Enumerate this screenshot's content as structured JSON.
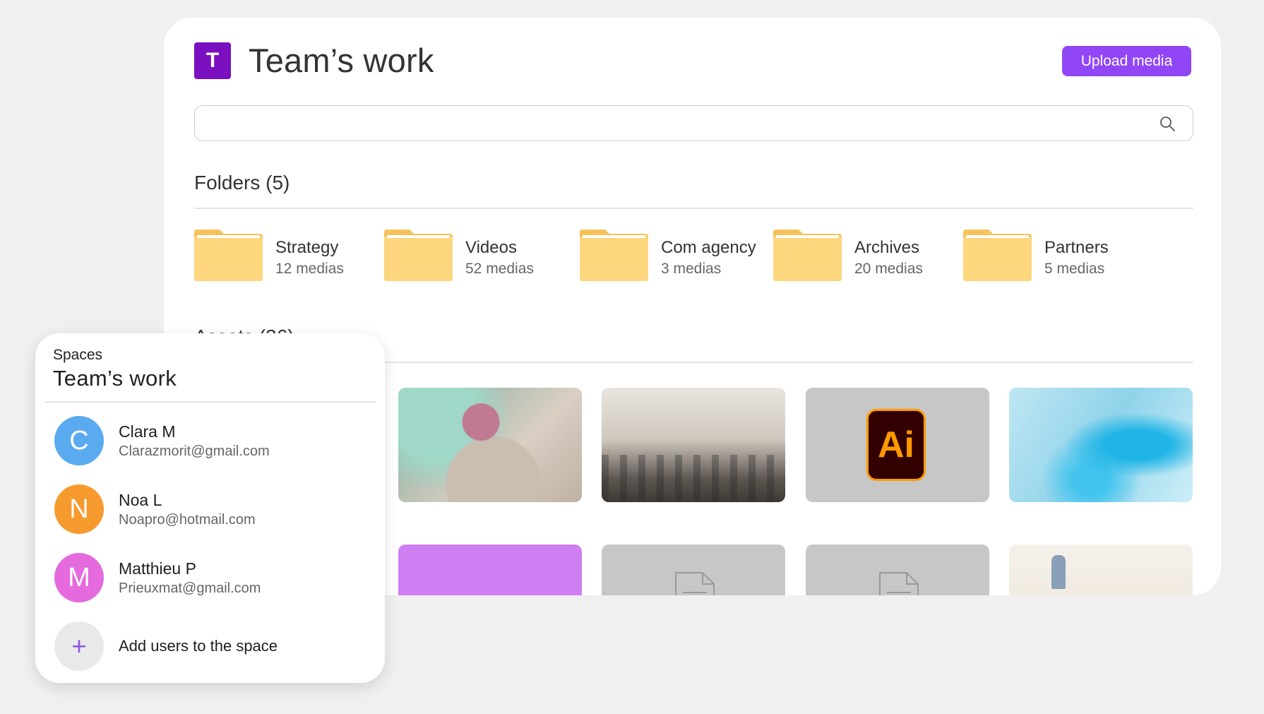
{
  "header": {
    "badge_letter": "T",
    "title": "Team’s work",
    "upload_label": "Upload media"
  },
  "search": {
    "placeholder": "",
    "value": ""
  },
  "folders": {
    "title": "Folders (5)",
    "items": [
      {
        "name": "Strategy",
        "count": "12 medias"
      },
      {
        "name": "Videos",
        "count": "52 medias"
      },
      {
        "name": "Com agency",
        "count": "3 medias"
      },
      {
        "name": "Archives",
        "count": "20 medias"
      },
      {
        "name": "Partners",
        "count": "5 medias"
      }
    ]
  },
  "assets": {
    "title": "Assets (36)",
    "items": [
      {
        "kind": "photo",
        "subject": "podcast host"
      },
      {
        "kind": "photo",
        "subject": "conference audience"
      },
      {
        "kind": "illustrator-file",
        "label": "Ai"
      },
      {
        "kind": "image",
        "subject": "abstract blue wave"
      },
      {
        "kind": "image",
        "subject": "purple silhouettes"
      },
      {
        "kind": "document"
      },
      {
        "kind": "document"
      },
      {
        "kind": "photo",
        "subject": "speaker presentation"
      }
    ]
  },
  "spaces_panel": {
    "label": "Spaces",
    "title": "Team’s work",
    "users": [
      {
        "initial": "C",
        "name": "Clara M",
        "email": "Clarazmorit@gmail.com",
        "color": "#5aaaf0"
      },
      {
        "initial": "N",
        "name": "Noa L",
        "email": "Noapro@hotmail.com",
        "color": "#f79a2e"
      },
      {
        "initial": "M",
        "name": "Matthieu P",
        "email": "Prieuxmat@gmail.com",
        "color": "#e46ade"
      }
    ],
    "add_icon": "+",
    "add_label": "Add users to the space"
  },
  "colors": {
    "accent": "#9146f5",
    "badge": "#7a0fc0",
    "folder": "#fdd67e",
    "background": "#f0f0f0"
  }
}
